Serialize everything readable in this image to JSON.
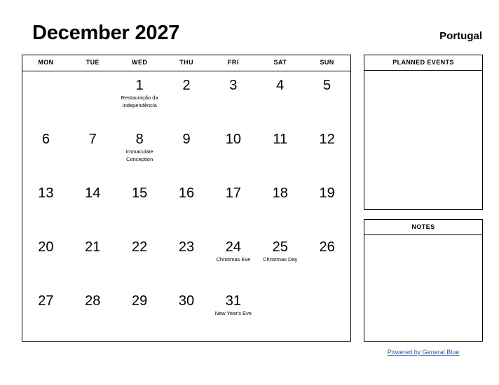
{
  "header": {
    "title": "December 2027",
    "country": "Portugal"
  },
  "calendar": {
    "weekdays": [
      "MON",
      "TUE",
      "WED",
      "THU",
      "FRI",
      "SAT",
      "SUN"
    ],
    "weeks": [
      [
        {
          "day": "",
          "event": ""
        },
        {
          "day": "",
          "event": ""
        },
        {
          "day": "1",
          "event": "Restauração da Independência"
        },
        {
          "day": "2",
          "event": ""
        },
        {
          "day": "3",
          "event": ""
        },
        {
          "day": "4",
          "event": ""
        },
        {
          "day": "5",
          "event": ""
        }
      ],
      [
        {
          "day": "6",
          "event": ""
        },
        {
          "day": "7",
          "event": ""
        },
        {
          "day": "8",
          "event": "Immaculate Conception"
        },
        {
          "day": "9",
          "event": ""
        },
        {
          "day": "10",
          "event": ""
        },
        {
          "day": "11",
          "event": ""
        },
        {
          "day": "12",
          "event": ""
        }
      ],
      [
        {
          "day": "13",
          "event": ""
        },
        {
          "day": "14",
          "event": ""
        },
        {
          "day": "15",
          "event": ""
        },
        {
          "day": "16",
          "event": ""
        },
        {
          "day": "17",
          "event": ""
        },
        {
          "day": "18",
          "event": ""
        },
        {
          "day": "19",
          "event": ""
        }
      ],
      [
        {
          "day": "20",
          "event": ""
        },
        {
          "day": "21",
          "event": ""
        },
        {
          "day": "22",
          "event": ""
        },
        {
          "day": "23",
          "event": ""
        },
        {
          "day": "24",
          "event": "Christmas Eve"
        },
        {
          "day": "25",
          "event": "Christmas Day"
        },
        {
          "day": "26",
          "event": ""
        }
      ],
      [
        {
          "day": "27",
          "event": ""
        },
        {
          "day": "28",
          "event": ""
        },
        {
          "day": "29",
          "event": ""
        },
        {
          "day": "30",
          "event": ""
        },
        {
          "day": "31",
          "event": "New Year's Eve"
        },
        {
          "day": "",
          "event": ""
        },
        {
          "day": "",
          "event": ""
        }
      ]
    ]
  },
  "panels": {
    "planned_events_title": "PLANNED EVENTS",
    "notes_title": "NOTES"
  },
  "footer": {
    "link_text": "Powered by General Blue",
    "link_color": "#2a5db0"
  }
}
